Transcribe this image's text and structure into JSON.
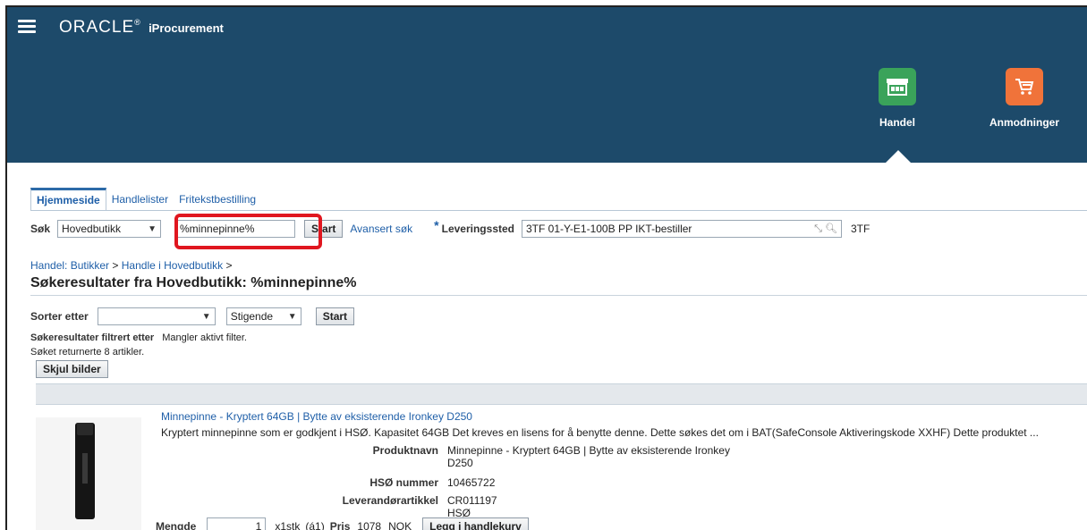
{
  "header": {
    "brand": "ORACLE",
    "product": "iProcurement",
    "tiles": [
      {
        "label": "Handel",
        "color": "#3aa35a"
      },
      {
        "label": "Anmodninger",
        "color": "#f0733a"
      }
    ]
  },
  "tabs": [
    "Hjemmeside",
    "Handlelister",
    "Fritekstbestilling"
  ],
  "search": {
    "label": "Søk",
    "store": "Hovedbutikk",
    "query": "%minnepinne%",
    "start_label": "Start",
    "advanced_label": "Avansert søk",
    "delivery_label": "Leveringssted",
    "delivery_value": "3TF 01-Y-E1-100B PP IKT-bestiller",
    "delivery_code": "3TF"
  },
  "breadcrumb": {
    "part1": "Handel: Butikker",
    "sep": ">",
    "part2": "Handle i Hovedbutikk",
    "part3": ">"
  },
  "page_title": "Søkeresultater fra Hovedbutikk: %minnepinne%",
  "sort": {
    "label": "Sorter etter",
    "field_value": "",
    "order_value": "Stigende",
    "start_label": "Start"
  },
  "filter": {
    "label": "Søkeresultater filtrert etter",
    "value": "Mangler aktivt filter."
  },
  "result_count": "Søket returnerte 8 artikler.",
  "hide_images_label": "Skjul bilder",
  "item": {
    "title": "Minnepinne - Kryptert 64GB | Bytte av eksisterende Ironkey D250",
    "description": "Kryptert minnepinne som er godkjent i HSØ. Kapasitet 64GB Det kreves en lisens for å benytte denne. Dette søkes det om i BAT(SafeConsole Aktiveringskode XXHF) Dette produktet ...",
    "product_name_label": "Produktnavn",
    "product_name_line1": "Minnepinne - Kryptert 64GB | Bytte av eksisterende Ironkey",
    "product_name_line2": "D250",
    "hso_label": "HSØ nummer",
    "hso_value": "10465722",
    "supplier_label": "Leverandørartikkel",
    "supplier_value": "CR011197 HSØ",
    "qty_label": "Mengde",
    "qty_value": "1",
    "unit": "x1stk",
    "unit_each": "(á1)",
    "price_label": "Pris",
    "price_value": "1078",
    "currency": "NOK",
    "add_to_cart": "Legg i handlekurv"
  }
}
